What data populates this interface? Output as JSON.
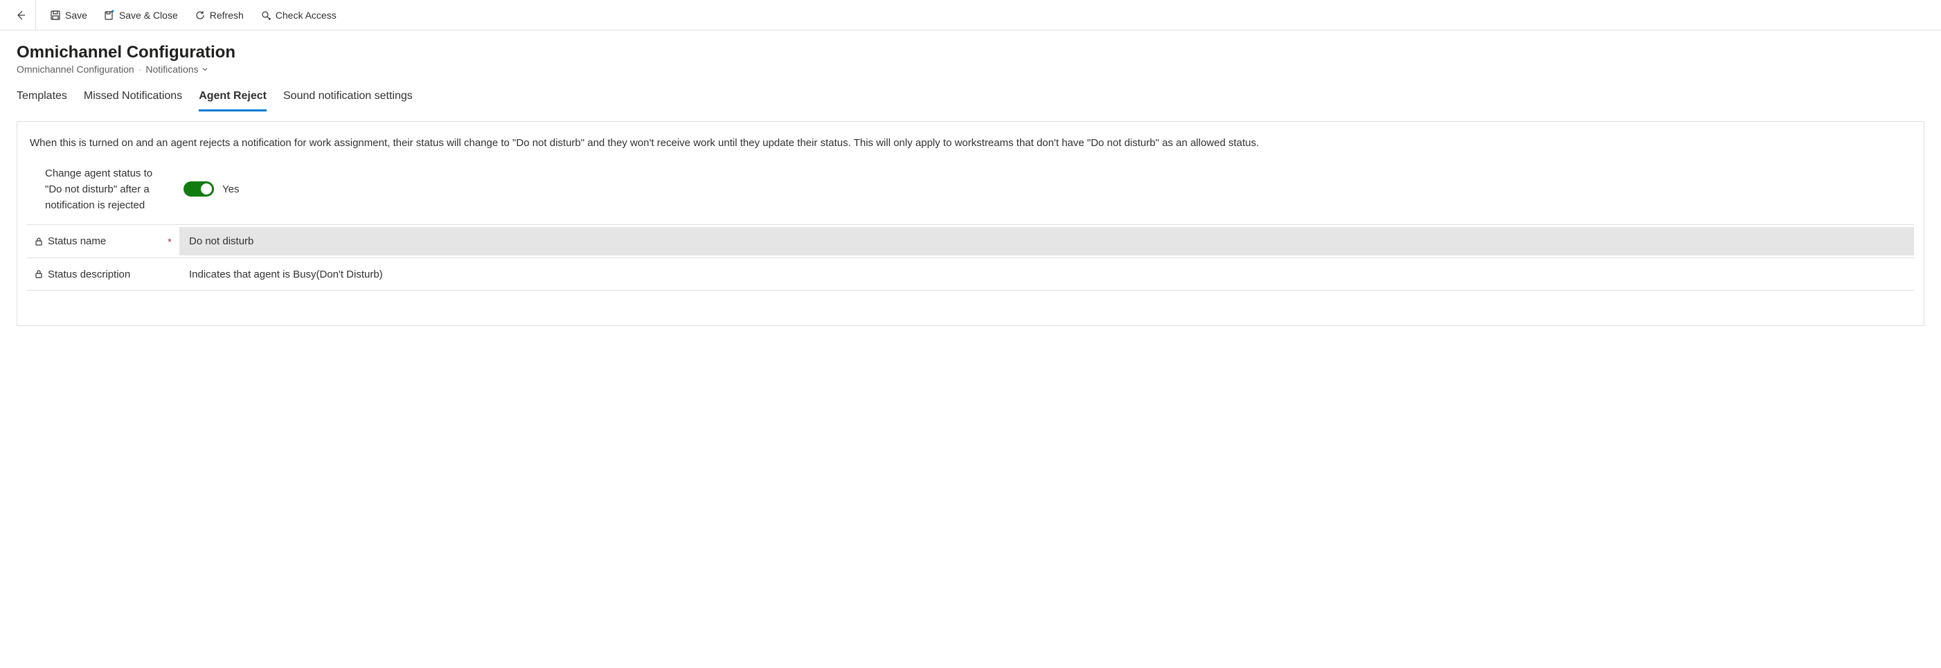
{
  "toolbar": {
    "save": "Save",
    "saveClose": "Save & Close",
    "refresh": "Refresh",
    "checkAccess": "Check Access"
  },
  "header": {
    "title": "Omnichannel Configuration",
    "breadcrumb1": "Omnichannel Configuration",
    "breadcrumb2": "Notifications"
  },
  "tabs": {
    "templates": "Templates",
    "missed": "Missed Notifications",
    "agentReject": "Agent Reject",
    "sound": "Sound notification settings"
  },
  "panel": {
    "description": "When this is turned on and an agent rejects a notification for work assignment, their status will change to \"Do not disturb\" and they won't receive work until they update their status. This will only apply to workstreams that don't have \"Do not disturb\" as an allowed status.",
    "toggleLabel": "Change agent status to \"Do not disturb\" after a notification is rejected",
    "toggleValue": "Yes",
    "fields": {
      "statusName": {
        "label": "Status name",
        "value": "Do not disturb",
        "required": "*"
      },
      "statusDescription": {
        "label": "Status description",
        "value": "Indicates that agent is Busy(Don't Disturb)"
      }
    }
  }
}
